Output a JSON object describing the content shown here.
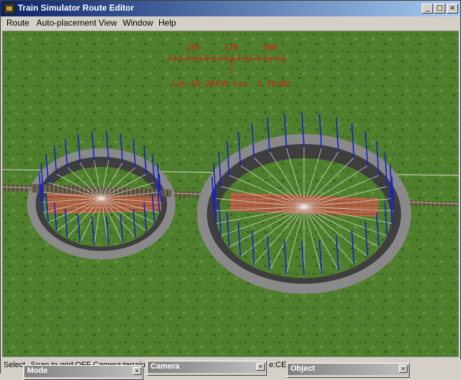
{
  "window": {
    "title": "Train Simulator Route Editor",
    "buttons": {
      "minimize": "_",
      "maximize": "□",
      "close": "×"
    }
  },
  "menu": [
    {
      "label": "Route",
      "key": "R"
    },
    {
      "label": "Auto-placement",
      "key": "A"
    },
    {
      "label": "View",
      "key": "V"
    },
    {
      "label": "Window",
      "key": "W"
    },
    {
      "label": "Help",
      "key": "H"
    }
  ],
  "compass": {
    "headings": [
      "240",
      "270",
      "300"
    ],
    "position_text": "Lat 50.38470 Lon -1.75c82",
    "color": "#d02010"
  },
  "status": {
    "text1": "Select",
    "text2": "Snap to grid:OFF Camera:terrain",
    "text3": "e:CE"
  },
  "panels": [
    {
      "title": "Mode",
      "close": "×"
    },
    {
      "title": "Camera",
      "close": "×"
    },
    {
      "title": "Object",
      "close": "×"
    }
  ],
  "colors": {
    "grass": "#4a7a2a",
    "title_start": "#0a246a",
    "title_end": "#a6caf0",
    "marker": "#1020d0"
  }
}
